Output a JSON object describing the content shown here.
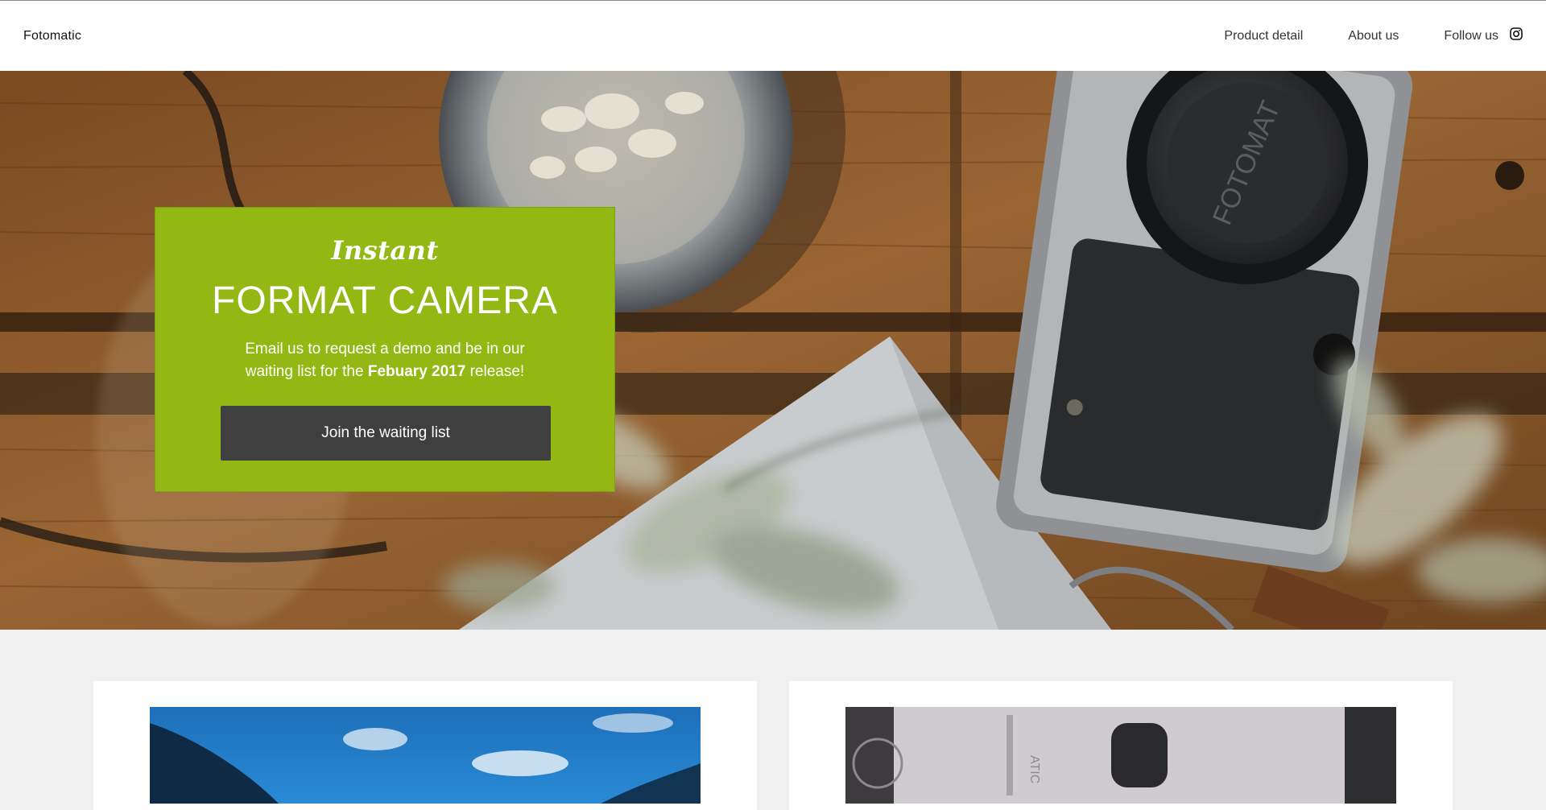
{
  "header": {
    "logo": "Fotomatic",
    "nav": {
      "product_detail": "Product detail",
      "about_us": "About us",
      "follow_us": "Follow us"
    }
  },
  "hero": {
    "promo": {
      "script_title": "Instant",
      "headline": "FORMAT CAMERA",
      "desc_before": "Email us to request a demo and be in our waiting list for the ",
      "desc_bold": "Febuary 2017",
      "desc_after": " release!",
      "cta_label": "Join the waiting list"
    },
    "camera_cap_text": "FOTOMAT",
    "accent_color": "#93b813",
    "button_color": "#3f3f3f"
  },
  "icons": {
    "follow": "instagram-icon"
  }
}
